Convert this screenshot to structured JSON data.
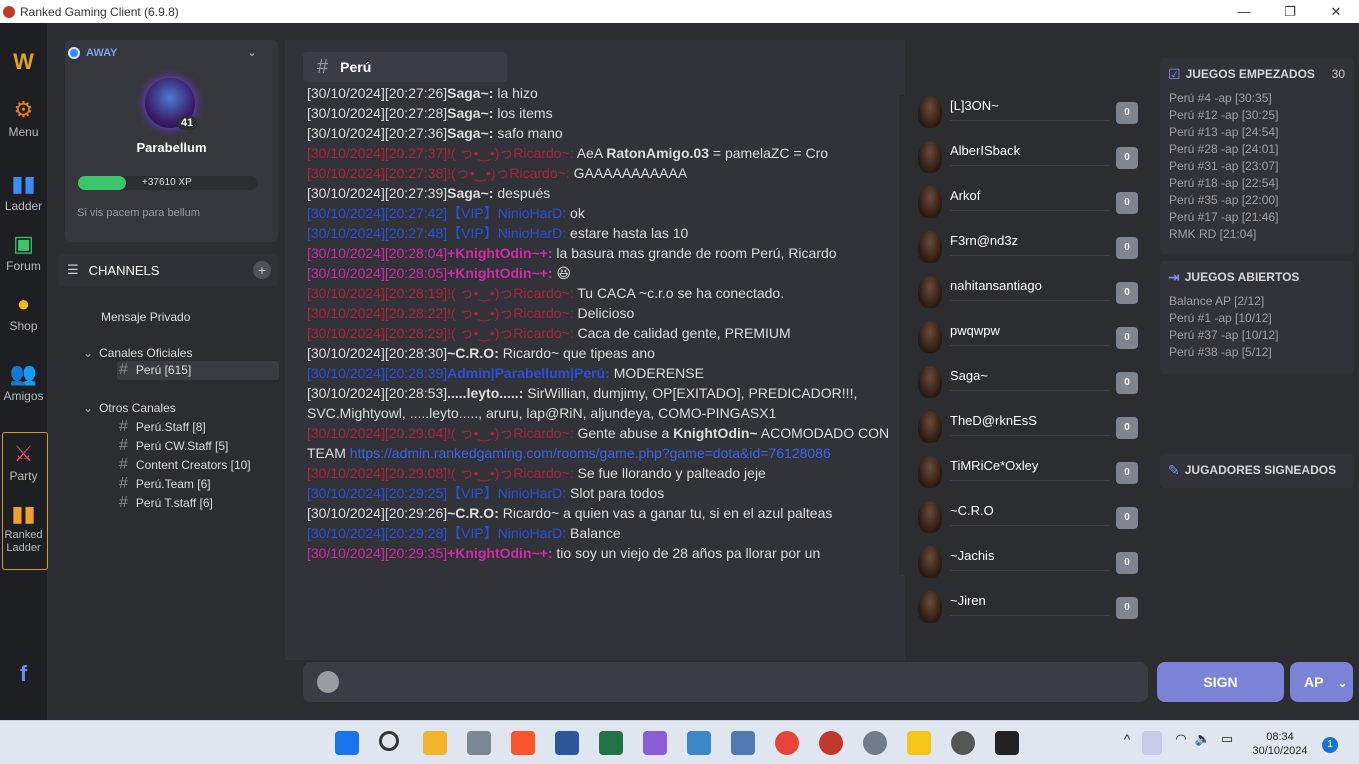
{
  "window": {
    "title": "Ranked Gaming Client (6.9.8)",
    "minimize": "—",
    "maximize": "❐",
    "close": "✕"
  },
  "nav": {
    "menu": "Menu",
    "ladder": "Ladder",
    "forum": "Forum",
    "shop": "Shop",
    "friends": "Amigos",
    "party": "Party",
    "ranked_ladder": "Ranked\nLadder"
  },
  "profile": {
    "status": "AWAY",
    "level": "41",
    "username": "Parabellum",
    "xp": "+37610 XP",
    "motto": "Si vis pacem para bellum"
  },
  "channels": {
    "header": "CHANNELS",
    "private": "Mensaje Privado",
    "official_group": "Canales Oficiales",
    "official": [
      "Perú [615]"
    ],
    "other_group": "Otros Canales",
    "other": [
      "Perú.Staff [8]",
      "Perú CW.Staff [5]",
      "Content Creators [10]",
      "Perú.Team [6]",
      "Perú T.staff [6]"
    ]
  },
  "chat": {
    "channel": "Perú",
    "messages": [
      {
        "ts": "[30/10/2024][20:27:26]",
        "user": "Saga~",
        "sep": ": ",
        "text": "la hizo"
      },
      {
        "ts": "[30/10/2024][20:27:28]",
        "user": "Saga~",
        "sep": ": ",
        "text": "los items"
      },
      {
        "ts": "[30/10/2024][20:27:36]",
        "user": "Saga~",
        "sep": ": ",
        "text": "safo mano"
      },
      {
        "ts": "[30/10/2024][20:27:37]",
        "user": "!( っ•‿•)っRicardo~",
        "sep": ": ",
        "text": "AeA ",
        "bold": "RatonAmigo.03",
        "rest": " = pamelaZC = Cro"
      },
      {
        "ts": "[30/10/2024][20:27:38]",
        "user": "!(っ•‿•)っRicardo~",
        "sep": ": ",
        "text": "GAAAAAAAAAAA"
      },
      {
        "ts": "[30/10/2024][20:27:39]",
        "user": "Saga~",
        "sep": ": ",
        "text": "después"
      },
      {
        "ts": "[30/10/2024][20:27:42]",
        "user": "【VIP】NinioHarD",
        "sep": ": ",
        "text": "ok"
      },
      {
        "ts": "[30/10/2024][20:27:48]",
        "user": "【VIP】NinioHarD",
        "sep": ": ",
        "text": "estare hasta las 10"
      },
      {
        "ts": "[30/10/2024][20:28:04]",
        "user": "+KnightOdin~+",
        "sep": ": ",
        "text": "la basura mas grande de room Perú, Ricardo"
      },
      {
        "ts": "[30/10/2024][20:28:05]",
        "user": "+KnightOdin~+",
        "sep": ": ",
        "text": "😆"
      },
      {
        "ts": "[30/10/2024][20:28:19]",
        "user": "!( っ•‿•)っRicardo~",
        "sep": ": ",
        "text": "Tu CACA ~c.r.o se ha conectado."
      },
      {
        "ts": "[30/10/2024][20:28:22]",
        "user": "!( っ•‿•)っRicardo~",
        "sep": ": ",
        "text": "Delicioso"
      },
      {
        "ts": "[30/10/2024][20:28:29]",
        "user": "!( っ•‿•)っRicardo~",
        "sep": ": ",
        "text": "Caca de calidad gente, PREMIUM"
      },
      {
        "ts": "[30/10/2024][20:28:30]",
        "user": "~C.R.O",
        "sep": ": ",
        "text": "Ricardo~ que tipeas ano"
      },
      {
        "ts": "[30/10/2024][20:28:39]",
        "user": "Admin|Parabellum|Perú",
        "sep": ": ",
        "text": "MODERENSE"
      },
      {
        "ts": "[30/10/2024][20:28:53]",
        "user": ".....leyto.....",
        "sep": ": ",
        "text": "SirWillian, dumjimy, OP[EXITADO], PREDICADOR!!!, SVC.Mightyowl, .....leyto....., aruru, lap@RiN, aljundeya, COMO-PINGASX1"
      },
      {
        "ts": "[30/10/2024][20:29:04]",
        "user": "!( っ•‿•)っRicardo~",
        "sep": ": ",
        "text": "Gente abuse a ",
        "bold": "KnightOdin~",
        "rest": " ACOMODADO CON TEAM ",
        "link": "https://admin.rankedgaming.com/rooms/game.php?game=dota&id=76128086"
      },
      {
        "ts": "[30/10/2024][20:29:08]",
        "user": "!( っ•‿•)っRicardo~",
        "sep": ": ",
        "text": "Se fue llorando y palteado jeje"
      },
      {
        "ts": "[30/10/2024][20:29:25]",
        "user": "【VIP】NinioHarD",
        "sep": ": ",
        "text": "Slot para todos"
      },
      {
        "ts": "[30/10/2024][20:29:26]",
        "user": "~C.R.O",
        "sep": ": ",
        "text": "Ricardo~ a quien vas a ganar tu, si en el azul palteas"
      },
      {
        "ts": "[30/10/2024][20:29:28]",
        "user": "【VIP】NinioHarD",
        "sep": ": ",
        "text": "Balance"
      },
      {
        "ts": "[30/10/2024][20:29:35]",
        "user": "+KnightOdin~+",
        "sep": ": ",
        "text": "tio soy un viejo de 28 años pa llorar por un"
      }
    ]
  },
  "users": [
    {
      "name": "[L]3ON~",
      "count": "0"
    },
    {
      "name": "AlberISback",
      "count": "0"
    },
    {
      "name": "Arkof",
      "count": "0"
    },
    {
      "name": "F3rn@nd3z",
      "count": "0"
    },
    {
      "name": "nahitansantiago",
      "count": "0"
    },
    {
      "name": "pwqwpw",
      "count": "0"
    },
    {
      "name": "Saga~",
      "count": "0"
    },
    {
      "name": "TheD@rknEsS",
      "count": "0"
    },
    {
      "name": "TiMRiCe*Oxley",
      "count": "0"
    },
    {
      "name": "~C.R.O",
      "count": "0"
    },
    {
      "name": "~Jachis",
      "count": "0"
    },
    {
      "name": "~Jiren",
      "count": "0"
    }
  ],
  "right": {
    "started_title": "JUEGOS EMPEZADOS",
    "started_count": "30",
    "started": [
      "Perú  #4 -ap [30:35]",
      "Perú  #12 -ap [30:25]",
      "Perú  #13 -ap [24:54]",
      "Perú  #28 -ap [24:01]",
      "Perú  #31 -ap [23:07]",
      "Perú  #18 -ap [22:54]",
      "Perú  #35 -ap [22:00]",
      "Perú  #17 -ap [21:46]",
      "RMK RD [21:04]"
    ],
    "open_title": "JUEGOS ABIERTOS",
    "open": [
      "Balance AP [2/12]",
      "Perú  #1 -ap [10/12]",
      "Perú  #37 -ap [10/12]",
      "Perú  #38 -ap [5/12]"
    ],
    "signed_title": "JUGADORES SIGNEADOS"
  },
  "composer": {
    "sign": "SIGN",
    "mode": "AP",
    "mode_caret": "⌄"
  },
  "taskbar": {
    "time": "08:34",
    "date": "30/10/2024",
    "notifications": "1"
  }
}
